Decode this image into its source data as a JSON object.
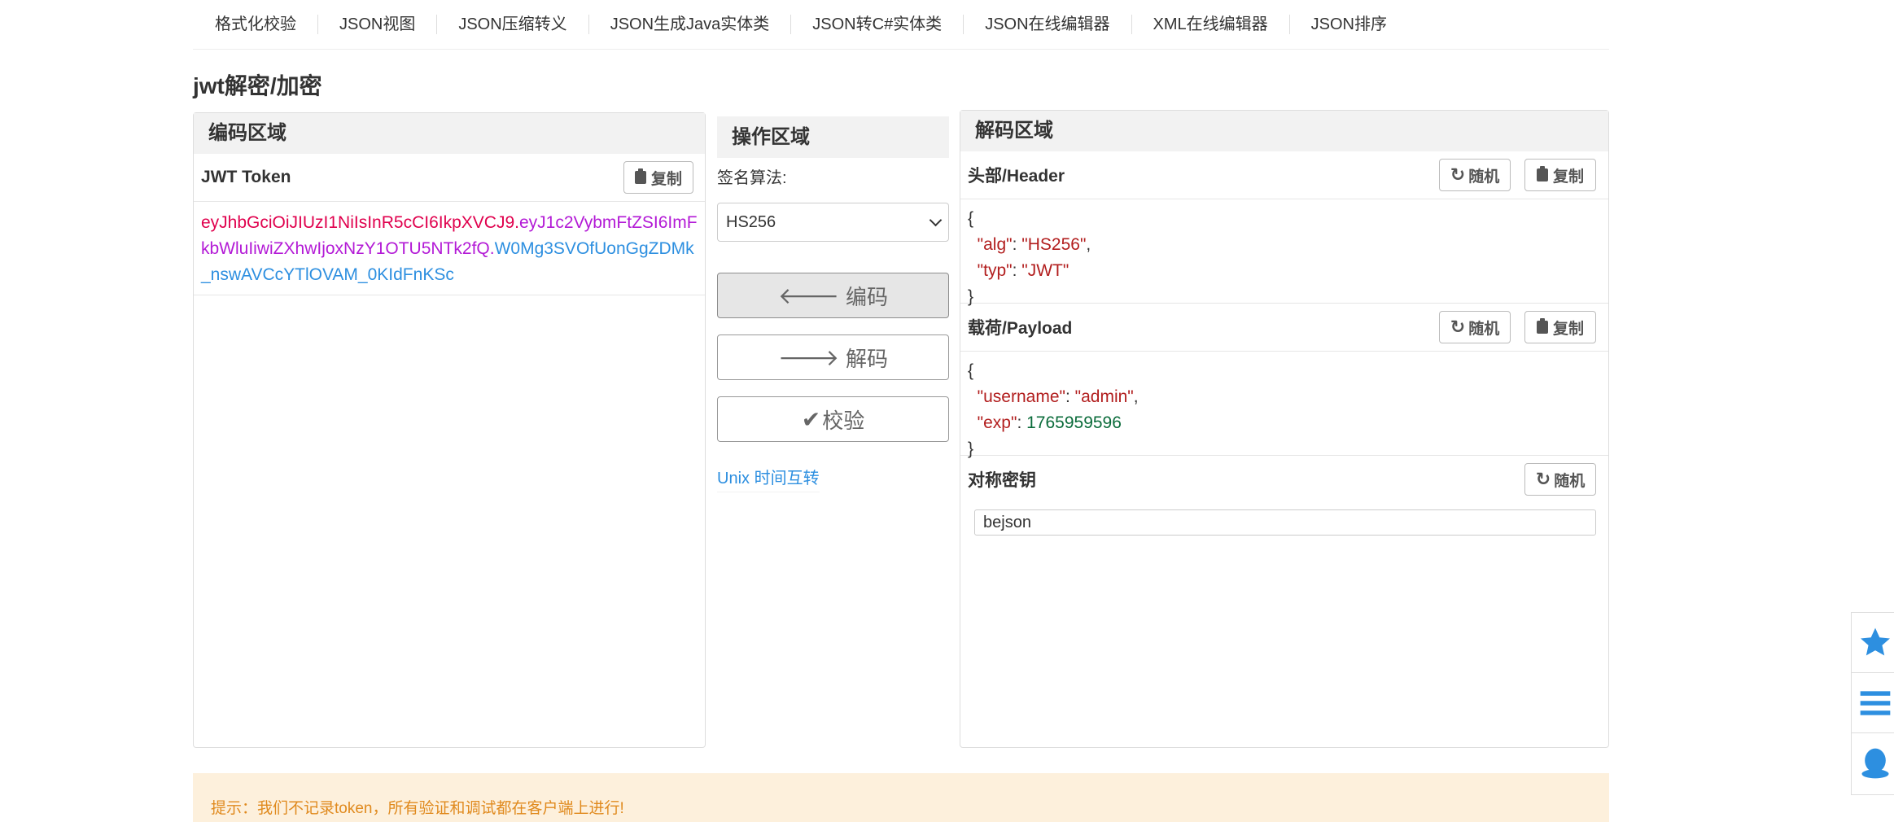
{
  "nav": {
    "items": [
      {
        "label": "格式化校验"
      },
      {
        "label": "JSON视图"
      },
      {
        "label": "JSON压缩转义"
      },
      {
        "label": "JSON生成Java实体类"
      },
      {
        "label": "JSON转C#实体类"
      },
      {
        "label": "JSON在线编辑器"
      },
      {
        "label": "XML在线编辑器"
      },
      {
        "label": "JSON排序"
      }
    ]
  },
  "page": {
    "title": "jwt解密/加密"
  },
  "encode": {
    "title": "编码区域",
    "token_label": "JWT Token",
    "copy_label": "复制",
    "token_header": "eyJhbGciOiJIUzI1NiIsInR5cCI6IkpXVCJ9",
    "token_payload": "eyJ1c2VybmFtZSI6ImFkbWluIiwiZXhwIjoxNzY1OTU5NTk2fQ",
    "token_signature": "W0Mg3SVOfUonGgZDMk_nswAVCcYTlOVAM_0KIdFnKSc",
    "dot": "."
  },
  "operation": {
    "title": "操作区域",
    "algo_label": "签名算法:",
    "algo_selected": "HS256",
    "encode_label": "编码",
    "decode_label": "解码",
    "verify_label": "校验",
    "unix_link": "Unix 时间互转"
  },
  "decode": {
    "title": "解码区域",
    "header_label": "头部/Header",
    "payload_label": "载荷/Payload",
    "secret_label": "对称密钥",
    "random_label": "随机",
    "copy_label": "复制",
    "header_json": {
      "open": "{",
      "close": "}",
      "alg_key": "\"alg\"",
      "alg_val": "\"HS256\"",
      "typ_key": "\"typ\"",
      "typ_val": "\"JWT\""
    },
    "payload_json": {
      "open": "{",
      "close": "}",
      "username_key": "\"username\"",
      "username_val": "\"admin\"",
      "exp_key": "\"exp\"",
      "exp_val": "1765959596"
    },
    "secret_value": "bejson"
  },
  "tip": {
    "text": "提示：我们不记录token，所有验证和调试都在客户端上进行!"
  },
  "colors": {
    "token_header": "#e0004d",
    "token_payload": "#b31ad6",
    "token_signature": "#2d8fe0",
    "tip_bg": "#fdf0dc",
    "tip_text": "#e08a1e",
    "side_icon": "#2d8fe0"
  },
  "side_tools": [
    "star-icon",
    "list-icon",
    "qq-icon"
  ]
}
